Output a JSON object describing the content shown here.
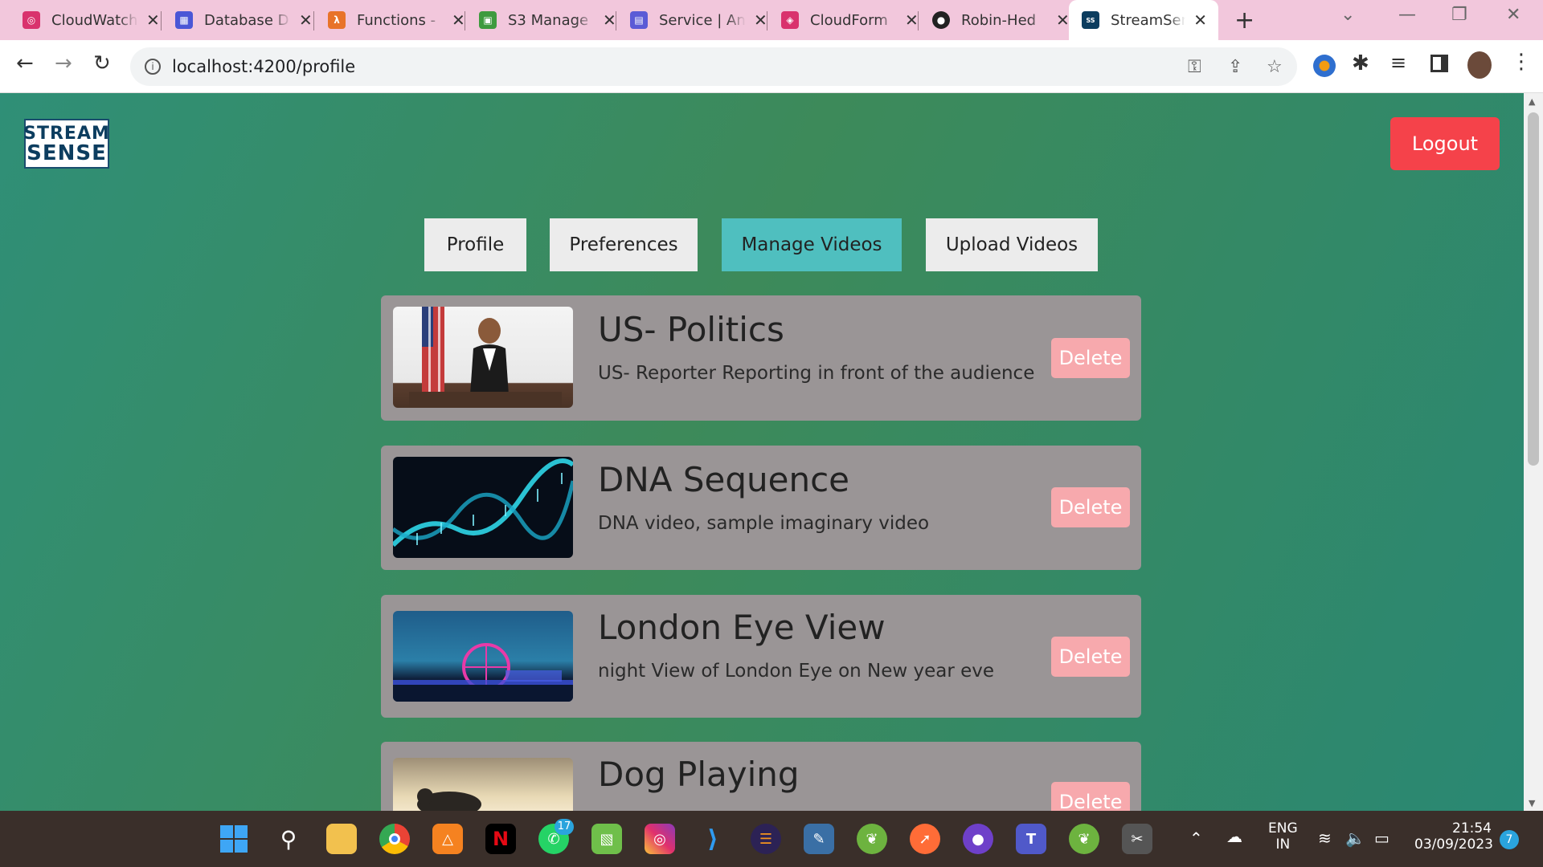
{
  "browser": {
    "tabs": [
      {
        "title": "CloudWatch",
        "icon": "cloudwatch-icon",
        "color": "#d9326d"
      },
      {
        "title": "Database D",
        "icon": "database-icon",
        "color": "#4a56d6"
      },
      {
        "title": "Functions -",
        "icon": "lambda-icon",
        "color": "#e8732a"
      },
      {
        "title": "S3 Manage",
        "icon": "s3-icon",
        "color": "#3e9a3e"
      },
      {
        "title": "Service | An",
        "icon": "service-icon",
        "color": "#5b5bd6"
      },
      {
        "title": "CloudForm",
        "icon": "cloudformation-icon",
        "color": "#d9326d"
      },
      {
        "title": "Robin-Hed",
        "icon": "github-icon",
        "color": "#222222"
      },
      {
        "title": "StreamSens",
        "icon": "streamsense-icon",
        "color": "#0c3d5f"
      }
    ],
    "url": "localhost:4200/profile"
  },
  "app": {
    "logo": {
      "line1": "STREAM",
      "line2": "SENSE"
    },
    "logout_label": "Logout",
    "nav": [
      {
        "label": "Profile",
        "active": false
      },
      {
        "label": "Preferences",
        "active": false
      },
      {
        "label": "Manage Videos",
        "active": true
      },
      {
        "label": "Upload Videos",
        "active": false
      }
    ],
    "videos": [
      {
        "title": "US- Politics",
        "description": "US- Reporter Reporting in front of the audience",
        "delete_label": "Delete"
      },
      {
        "title": "DNA Sequence",
        "description": "DNA video, sample imaginary video",
        "delete_label": "Delete"
      },
      {
        "title": "London Eye View",
        "description": "night View of London Eye on New year eve",
        "delete_label": "Delete"
      },
      {
        "title": "Dog Playing",
        "description": "",
        "delete_label": "Delete"
      }
    ]
  },
  "taskbar": {
    "whatsapp_badge": "17",
    "language": "ENG",
    "region": "IN",
    "time": "21:54",
    "date": "03/09/2023",
    "notification_count": "7"
  }
}
